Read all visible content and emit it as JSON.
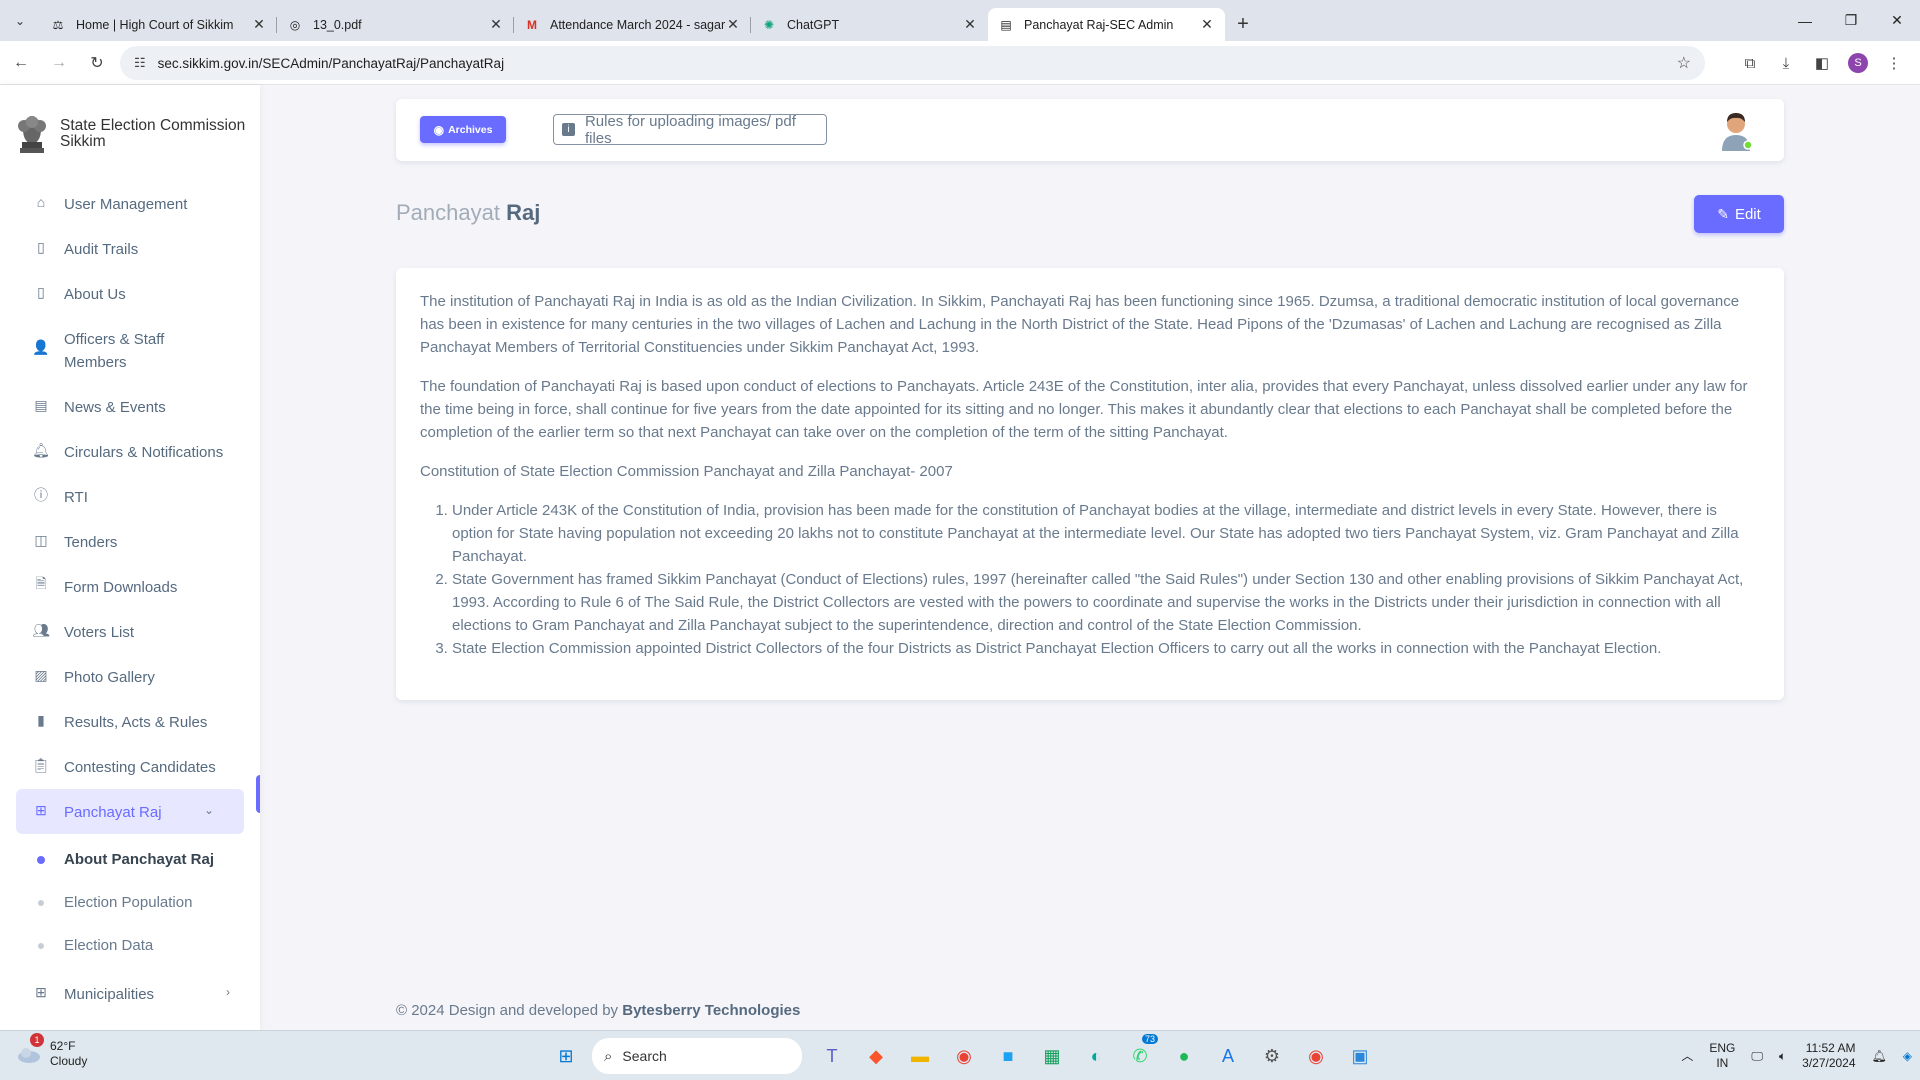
{
  "browser": {
    "tabs": [
      {
        "title": "Home | High Court of Sikkim",
        "icon": "court-favicon"
      },
      {
        "title": "13_0.pdf",
        "icon": "globe-favicon"
      },
      {
        "title": "Attendance March 2024 - sagar",
        "icon": "gmail-favicon"
      },
      {
        "title": "ChatGPT",
        "icon": "chatgpt-favicon"
      },
      {
        "title": "Panchayat Raj-SEC Admin",
        "icon": "page-favicon"
      }
    ],
    "url": "sec.sikkim.gov.in/SECAdmin/PanchayatRaj/PanchayatRaj",
    "profile_initial": "S"
  },
  "sidebar": {
    "brand": "State Election Commission Sikkim",
    "items": [
      {
        "label": "User Management",
        "icon": "home-icon"
      },
      {
        "label": "Audit Trails",
        "icon": "book-icon"
      },
      {
        "label": "About Us",
        "icon": "book-icon"
      },
      {
        "label": "Officers & Staff Members",
        "icon": "users-icon"
      },
      {
        "label": "News & Events",
        "icon": "news-icon"
      },
      {
        "label": "Circulars & Notifications",
        "icon": "bell-icon"
      },
      {
        "label": "RTI",
        "icon": "info-icon"
      },
      {
        "label": "Tenders",
        "icon": "columns-icon"
      },
      {
        "label": "Form Downloads",
        "icon": "file-icon"
      },
      {
        "label": "Voters List",
        "icon": "users-icon"
      },
      {
        "label": "Photo Gallery",
        "icon": "image-icon"
      },
      {
        "label": "Results, Acts & Rules",
        "icon": "bar-chart-icon"
      },
      {
        "label": "Contesting Candidates",
        "icon": "clipboard-icon"
      },
      {
        "label": "Panchayat Raj",
        "icon": "layout-icon"
      }
    ],
    "subitems": [
      "About Panchayat Raj",
      "Election Population",
      "Election Data"
    ],
    "last_item": {
      "label": "Municipalities",
      "icon": "layout-icon"
    }
  },
  "topbar": {
    "archives_label": "Archives",
    "rules_label": "Rules for uploading images/ pdf files"
  },
  "page": {
    "title_light": "Panchayat",
    "title_bold": "Raj",
    "edit_label": "Edit"
  },
  "content": {
    "p1": "The institution of Panchayati Raj in India is as old as the Indian Civilization. In Sikkim, Panchayati Raj has been functioning since 1965. Dzumsa, a traditional democratic institution of local governance has been in existence for many centuries in the two villages of Lachen and Lachung in the North District of the State. Head Pipons of the 'Dzumasas' of Lachen and Lachung are recognised as Zilla Panchayat Members of Territorial Constituencies under Sikkim Panchayat Act, 1993.",
    "p2": "The foundation of Panchayati Raj is based upon conduct of elections to Panchayats. Article 243E of the Constitution, inter alia, provides that every Panchayat, unless dissolved earlier under any law for the time being in force, shall continue for five years from the date appointed for its sitting and no longer. This makes it abundantly clear that elections to each Panchayat shall be completed before the completion of the earlier term so that next Panchayat can take over on the completion of the term of the sitting Panchayat.",
    "p3": "Constitution of State Election Commission Panchayat and Zilla Panchayat- 2007",
    "list": [
      "Under Article 243K of the Constitution of India, provision has been made for the constitution of Panchayat bodies at the village, intermediate and district levels in every State. However, there is option for State having population not exceeding 20 lakhs not to constitute Panchayat at the intermediate level. Our State has adopted two tiers Panchayat System, viz. Gram Panchayat and Zilla Panchayat.",
      "State Government has framed Sikkim Panchayat (Conduct of Elections) rules, 1997 (hereinafter called \"the Said Rules\") under Section 130 and other enabling provisions of Sikkim Panchayat Act, 1993. According to Rule 6 of The Said Rule, the District Collectors are vested with the powers to coordinate and supervise the works in the Districts under their jurisdiction in connection with all elections to Gram Panchayat and Zilla Panchayat subject to the superintendence, direction and control of the State Election Commission.",
      "State Election Commission appointed District Collectors of the four Districts as District Panchayat Election Officers to carry out all the works in connection with the Panchayat Election."
    ]
  },
  "footer": {
    "prefix": "© 2024 Design and developed by",
    "company": "Bytesberry Technologies"
  },
  "taskbar": {
    "weather_temp": "62°F",
    "weather_desc": "Cloudy",
    "weather_badge": "1",
    "search_label": "Search",
    "whatsapp_badge": "73",
    "lang": "ENG",
    "region": "IN",
    "time": "11:52 AM",
    "date": "3/27/2024"
  }
}
